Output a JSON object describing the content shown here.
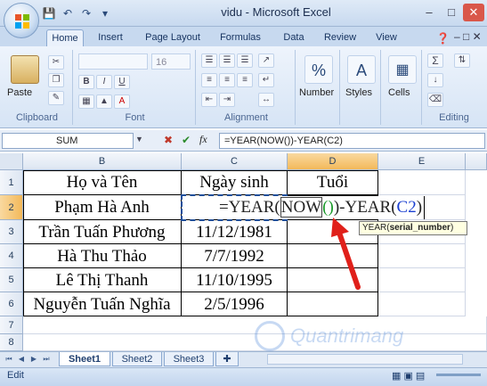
{
  "window": {
    "title": "vidu - Microsoft Excel"
  },
  "quick_access": [
    "save-icon",
    "undo-icon",
    "redo-icon",
    "customize-icon"
  ],
  "ribbon_tabs": [
    "Home",
    "Insert",
    "Page Layout",
    "Formulas",
    "Data",
    "Review",
    "View"
  ],
  "ribbon": {
    "clipboard": {
      "paste": "Paste",
      "label": "Clipboard"
    },
    "font": {
      "size": "16",
      "label": "Font"
    },
    "alignment": {
      "label": "Alignment"
    },
    "number": {
      "label": "Number"
    },
    "styles": {
      "label": "Styles"
    },
    "cells": {
      "label": "Cells"
    },
    "editing": {
      "label": "Editing"
    }
  },
  "formula_bar": {
    "name_box": "SUM",
    "fx": "fx",
    "formula": "=YEAR(NOW())-YEAR(C2)"
  },
  "columns": [
    "B",
    "C",
    "D",
    "E"
  ],
  "rows": [
    "1",
    "2",
    "3",
    "4",
    "5",
    "6",
    "7",
    "8"
  ],
  "table": {
    "headers": [
      "Họ và Tên",
      "Ngày sinh",
      "Tuổi"
    ],
    "rows": [
      {
        "name": "Phạm Hà Anh",
        "dob": ""
      },
      {
        "name": "Trần Tuấn Phương",
        "dob": "11/12/1981"
      },
      {
        "name": "Hà Thu Thảo",
        "dob": "7/7/1992"
      },
      {
        "name": "Lê Thị Thanh",
        "dob": "11/10/1995"
      },
      {
        "name": "Nguyễn Tuấn Nghĩa",
        "dob": "2/5/1996"
      }
    ]
  },
  "edit_cell": {
    "part1": "=YEAR(",
    "part2": "NOW",
    "part3": "()",
    "part4": ")-YEAR(",
    "part5": "C2",
    "part6": ")"
  },
  "tooltip": {
    "fn": "YEAR(",
    "arg": "serial_number",
    "close": ")"
  },
  "sheets": [
    "Sheet1",
    "Sheet2",
    "Sheet3"
  ],
  "status": {
    "mode": "Edit"
  },
  "watermark": "Quantrimang",
  "colors": {
    "accent": "#1f4e9a",
    "highlight": "#f3b95a",
    "arrow": "#e0201a",
    "ref_blue": "#1a3fd1",
    "ref_green": "#1a9a2a"
  }
}
